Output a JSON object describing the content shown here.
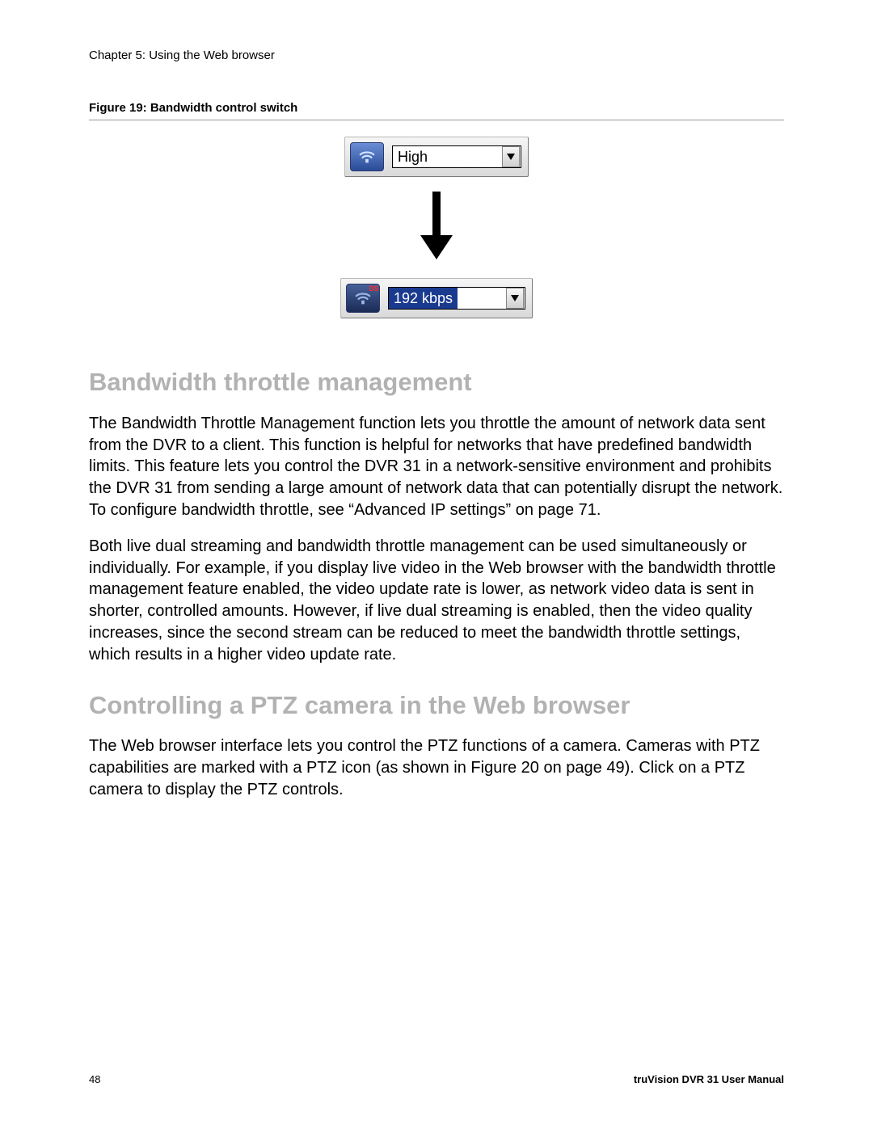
{
  "header": {
    "chapter": "Chapter 5: Using the Web browser"
  },
  "figure": {
    "caption": "Figure 19: Bandwidth control switch",
    "top_select": {
      "value": "High",
      "icon_badge": ""
    },
    "bottom_select": {
      "value": "192 kbps",
      "icon_badge": "DS"
    }
  },
  "sections": {
    "bandwidth": {
      "title": "Bandwidth throttle management",
      "p1": "The Bandwidth Throttle Management function lets you throttle the amount of network data sent from the DVR to a client. This function is helpful for networks that have predefined bandwidth limits. This feature lets you control the DVR 31 in a network-sensitive environment and prohibits the DVR 31 from sending a large amount of network data that can potentially disrupt the network. To configure bandwidth throttle, see “Advanced IP settings” on page 71.",
      "p2": "Both live dual streaming and bandwidth throttle management can be used simultaneously or individually. For example, if you display live video in the Web browser with the bandwidth throttle management feature enabled, the video update rate is lower, as network video data is sent in shorter, controlled amounts. However, if live dual streaming is enabled, then the video quality increases, since the second stream can be reduced to meet the bandwidth throttle settings, which results in a higher video update rate."
    },
    "ptz": {
      "title": "Controlling a PTZ camera in the Web browser",
      "p1": "The Web browser interface lets you control the PTZ functions of a camera. Cameras with PTZ capabilities are marked with a PTZ icon (as shown in Figure 20 on page 49). Click on a PTZ camera to display the PTZ controls."
    }
  },
  "footer": {
    "page_number": "48",
    "manual_name": "truVision DVR 31 User Manual"
  }
}
